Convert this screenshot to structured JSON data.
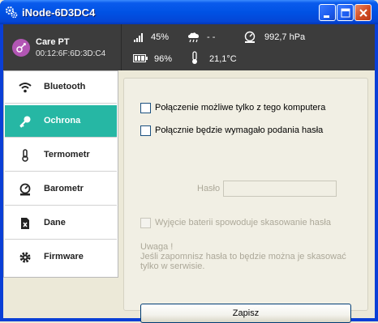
{
  "window": {
    "title": "iNode-6D3DC4"
  },
  "device": {
    "name": "Care PT",
    "mac": "00:12:6F:6D:3D:C4"
  },
  "stats": {
    "signal": "45%",
    "rain": "- -",
    "pressure": "992,7 hPa",
    "battery": "96%",
    "temperature": "21,1°C"
  },
  "sidebar": {
    "items": [
      {
        "label": "Bluetooth",
        "icon": "wifi-icon"
      },
      {
        "label": "Ochrona",
        "icon": "key-icon",
        "active": true
      },
      {
        "label": "Termometr",
        "icon": "thermometer-icon"
      },
      {
        "label": "Barometr",
        "icon": "barometer-icon"
      },
      {
        "label": "Dane",
        "icon": "data-file-icon"
      },
      {
        "label": "Firmware",
        "icon": "gear-icon"
      }
    ]
  },
  "protection": {
    "option1": "Połączenie możliwe tylko z tego komputera",
    "option2": "Połącznie będzie wymagało podania hasła",
    "password_label": "Hasło",
    "password_value": "",
    "battery_option": "Wyjęcie baterii spowoduje skasowanie hasła",
    "note_title": "Uwaga !",
    "note_line1": "Jeśli zapomnisz hasła to będzie można je skasować",
    "note_line2": "tylko w serwisie.",
    "save_label": "Zapisz"
  },
  "colors": {
    "accent": "#26b7a4",
    "header_bg": "#3c3c3c",
    "titlebar": "#0052e4"
  }
}
